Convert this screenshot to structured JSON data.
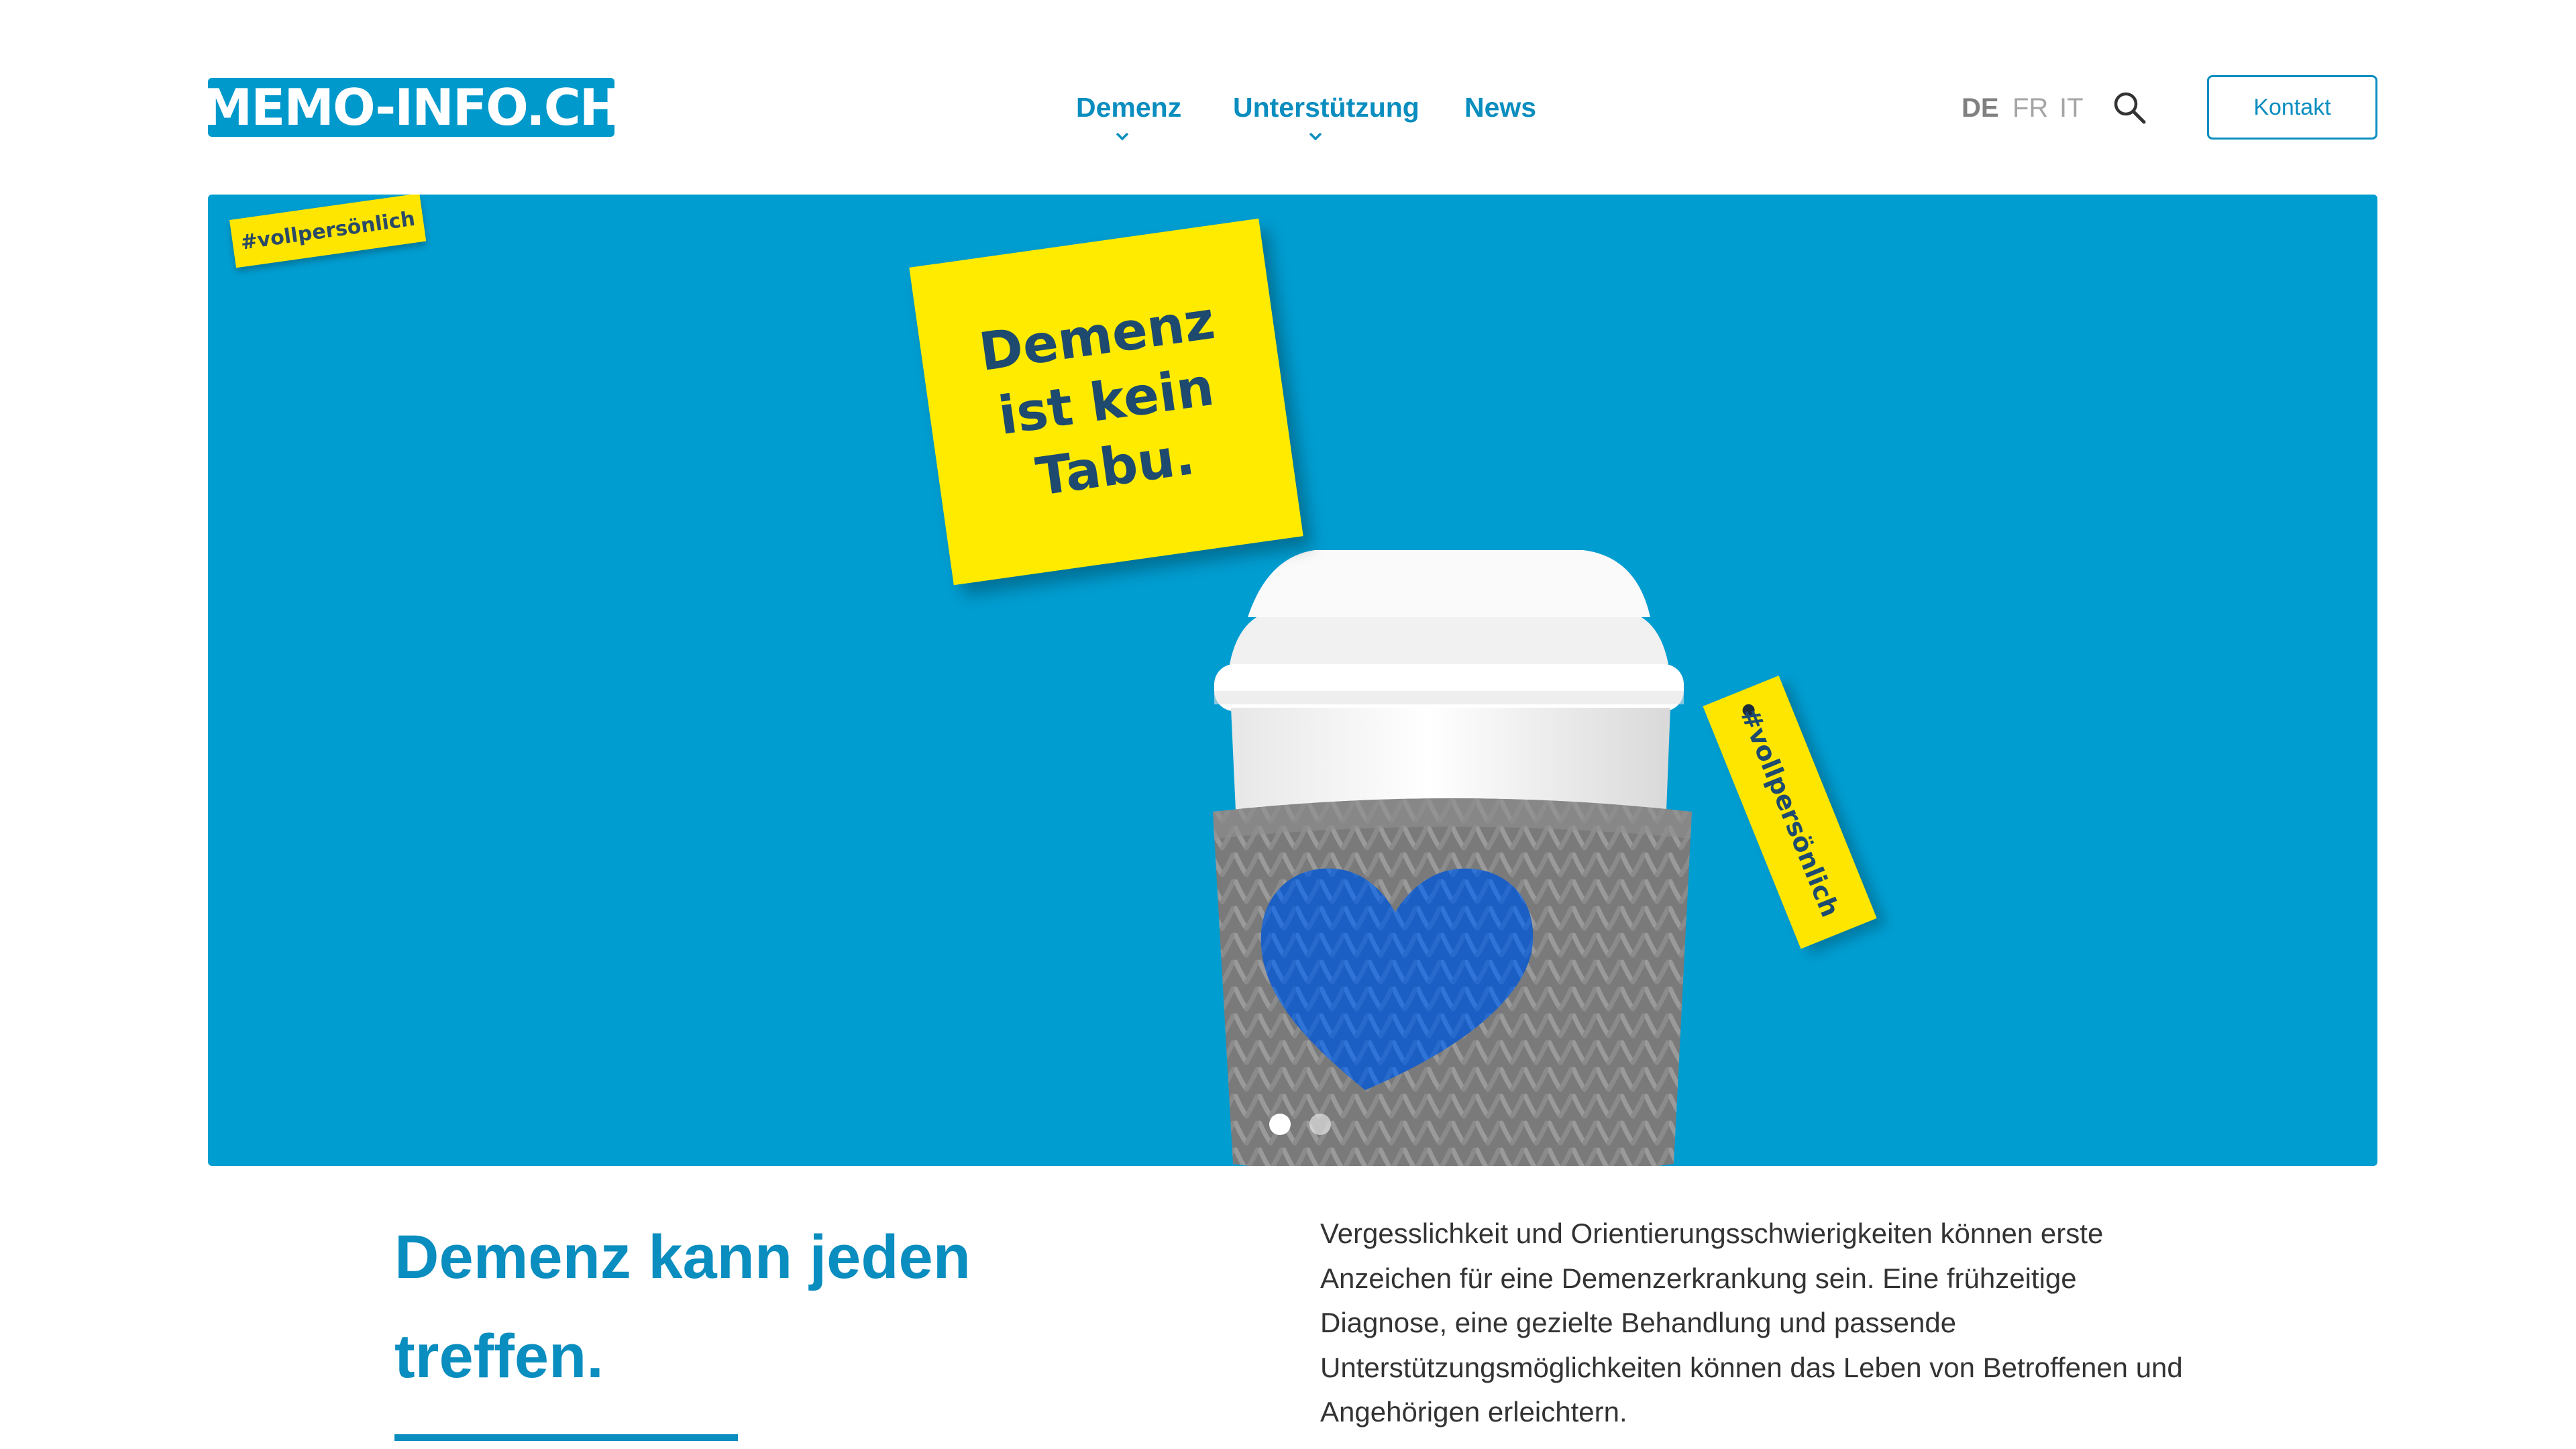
{
  "header": {
    "logo_text": "MEMO-INFO.CH",
    "nav": [
      {
        "label": "Demenz",
        "has_dropdown": true
      },
      {
        "label": "Unterstützung",
        "has_dropdown": true
      },
      {
        "label": "News",
        "has_dropdown": false
      }
    ],
    "languages": [
      {
        "code": "DE",
        "active": true
      },
      {
        "code": "FR",
        "active": false
      },
      {
        "code": "IT",
        "active": false
      }
    ],
    "search_icon": "search-icon",
    "contact_label": "Kontakt"
  },
  "hero": {
    "corner_tag": "#vollpersönlich",
    "note_text": "Demenz ist kein Tabu.",
    "cup_tag": "#vollpersönlich",
    "slides_total": 2,
    "active_slide": 1
  },
  "content": {
    "headline": "Demenz kann jeden treffen.",
    "intro": "Vergesslichkeit und Orientierungsschwierigkeiten können erste Anzeichen für eine Demenzerkrankung sein. Eine frühzeitige Diagnose, eine gezielte Behandlung und passende Unterstützungsmöglichkeiten können das Leben von Betroffenen und Angehörigen erleichtern."
  },
  "colors": {
    "brand_blue": "#0a8dbf",
    "hero_background": "#009dd1",
    "note_yellow": "#ffeb00",
    "heart_blue": "#1b5fc4",
    "knit_gray": "#7d7d7d"
  }
}
